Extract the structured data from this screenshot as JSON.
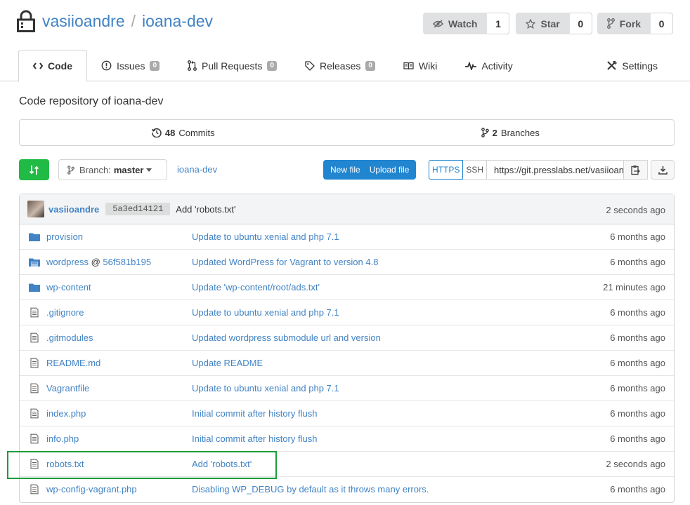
{
  "repo": {
    "owner": "vasiioandre",
    "separator": "/",
    "name": "ioana-dev",
    "description": "Code repository of ioana-dev"
  },
  "actions": [
    {
      "label": "Watch",
      "count": "1",
      "icon": "eye-slash-icon"
    },
    {
      "label": "Star",
      "count": "0",
      "icon": "star-icon"
    },
    {
      "label": "Fork",
      "count": "0",
      "icon": "fork-icon"
    }
  ],
  "tabs": [
    {
      "label": "Code",
      "icon": "code-icon",
      "active": true
    },
    {
      "label": "Issues",
      "badge": "0",
      "icon": "issue-icon"
    },
    {
      "label": "Pull Requests",
      "badge": "0",
      "icon": "pull-request-icon"
    },
    {
      "label": "Releases",
      "badge": "0",
      "icon": "tag-icon"
    },
    {
      "label": "Wiki",
      "icon": "book-icon"
    },
    {
      "label": "Activity",
      "icon": "pulse-icon"
    },
    {
      "label": "Settings",
      "icon": "tools-icon"
    }
  ],
  "stats": {
    "commits_count": "48",
    "commits_label": "Commits",
    "branches_count": "2",
    "branches_label": "Branches"
  },
  "toolbar": {
    "branch_prefix": "Branch:",
    "branch_name": "master",
    "path": "ioana-dev",
    "new_file": "New file",
    "upload_file": "Upload file",
    "https": "HTTPS",
    "ssh": "SSH",
    "clone_url": "https://git.presslabs.net/vasiioandre/ioana-dev.git"
  },
  "last_commit": {
    "author": "vasiioandre",
    "sha": "5a3ed14121",
    "message": "Add 'robots.txt'",
    "time": "2 seconds ago"
  },
  "files": [
    {
      "type": "folder",
      "name": "provision",
      "message": "Update to ubuntu xenial and php 7.1",
      "time": "6 months ago"
    },
    {
      "type": "submodule",
      "name": "wordpress",
      "at": "@",
      "ref": "56f581b195",
      "message": "Updated WordPress for Vagrant to version 4.8",
      "time": "6 months ago"
    },
    {
      "type": "folder",
      "name": "wp-content",
      "message": "Update 'wp-content/root/ads.txt'",
      "time": "21 minutes ago"
    },
    {
      "type": "file",
      "name": ".gitignore",
      "message": "Update to ubuntu xenial and php 7.1",
      "time": "6 months ago"
    },
    {
      "type": "file",
      "name": ".gitmodules",
      "message": "Updated wordpress submodule url and version",
      "time": "6 months ago"
    },
    {
      "type": "file",
      "name": "README.md",
      "message": "Update README",
      "time": "6 months ago"
    },
    {
      "type": "file",
      "name": "Vagrantfile",
      "message": "Update to ubuntu xenial and php 7.1",
      "time": "6 months ago"
    },
    {
      "type": "file",
      "name": "index.php",
      "message": "Initial commit after history flush",
      "time": "6 months ago"
    },
    {
      "type": "file",
      "name": "info.php",
      "message": "Initial commit after history flush",
      "time": "6 months ago"
    },
    {
      "type": "file",
      "name": "robots.txt",
      "message": "Add 'robots.txt'",
      "time": "2 seconds ago"
    },
    {
      "type": "file",
      "name": "wp-config-vagrant.php",
      "message": "Disabling WP_DEBUG by default as it throws many errors.",
      "time": "6 months ago"
    }
  ],
  "colors": {
    "link": "#4183c4",
    "primary": "#2185d0",
    "green": "#21ba45",
    "highlight": "#1e9b3a"
  }
}
